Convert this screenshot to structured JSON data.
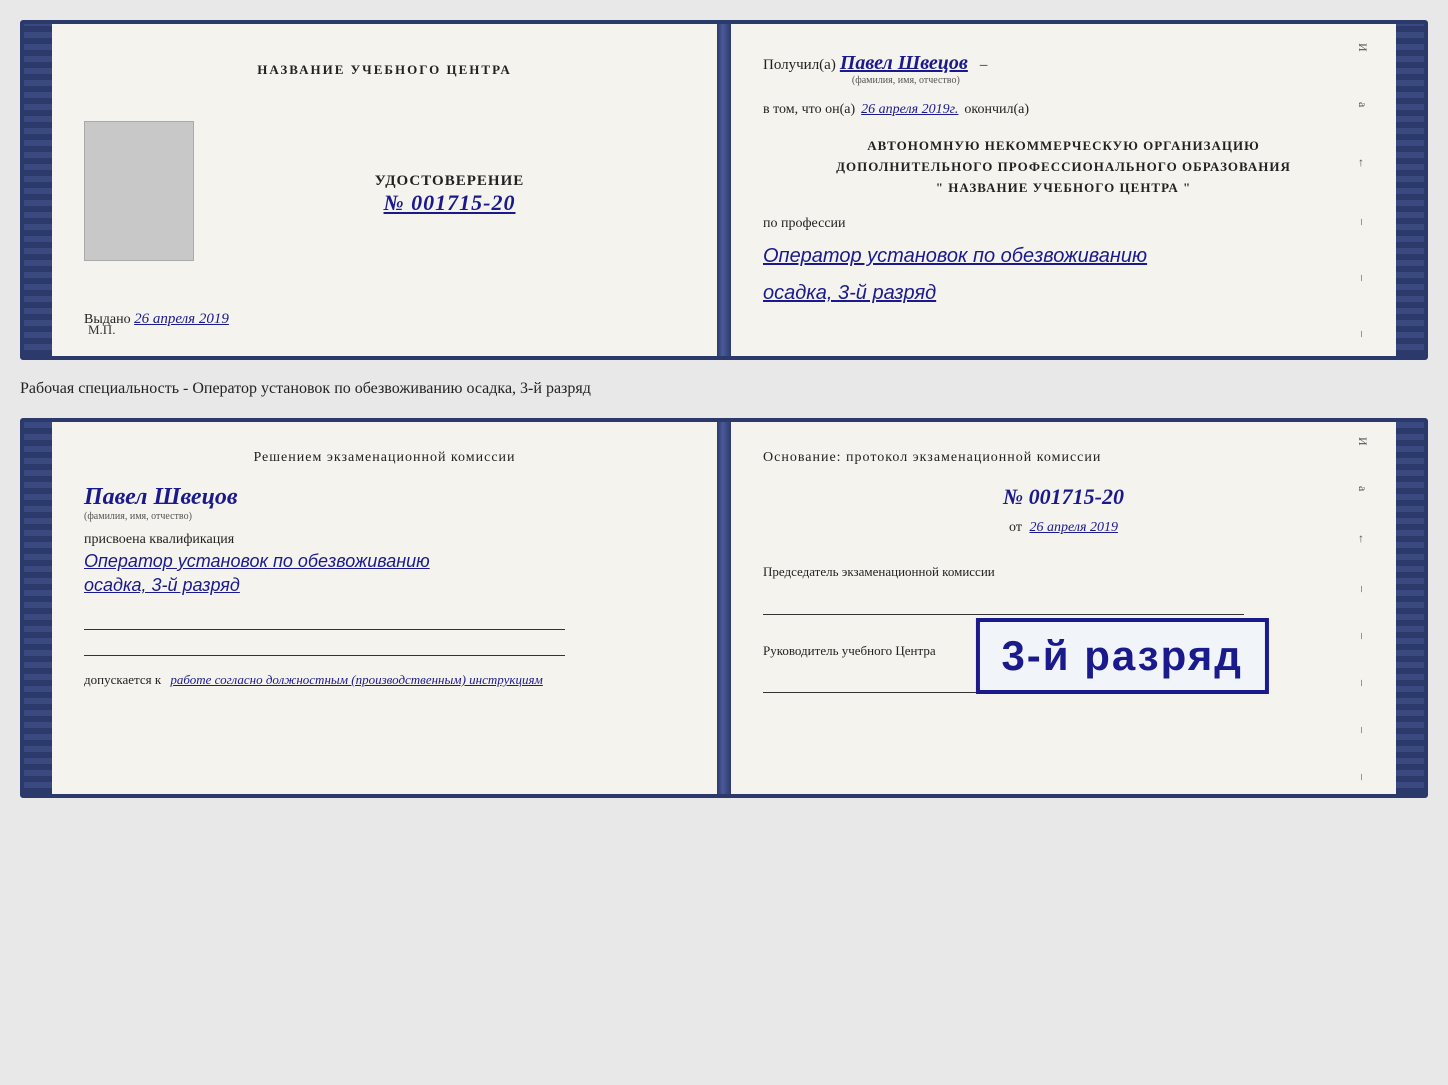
{
  "top_document": {
    "left": {
      "center_title": "НАЗВАНИЕ УЧЕБНОГО ЦЕНТРА",
      "cert_label": "УДОСТОВЕРЕНИЕ",
      "cert_number": "№ 001715-20",
      "issued_text": "Выдано",
      "issued_date": "26 апреля 2019",
      "mp_label": "М.П."
    },
    "right": {
      "received_prefix": "Получил(а)",
      "recipient_name": "Павел Швецов",
      "fio_label": "(фамилия, имя, отчество)",
      "that_prefix": "в том, что он(а)",
      "date_value": "26 апреля 2019г.",
      "finished_label": "окончил(а)",
      "org_line1": "АВТОНОМНУЮ НЕКОММЕРЧЕСКУЮ ОРГАНИЗАЦИЮ",
      "org_line2": "ДОПОЛНИТЕЛЬНОГО ПРОФЕССИОНАЛЬНОГО ОБРАЗОВАНИЯ",
      "org_line3": "\"  НАЗВАНИЕ УЧЕБНОГО ЦЕНТРА  \"",
      "profession_label": "по профессии",
      "profession_value": "Оператор установок по обезвоживанию",
      "rank_value": "осадка, 3-й разряд"
    }
  },
  "caption": "Рабочая специальность - Оператор установок по обезвоживанию осадка, 3-й разряд",
  "bottom_document": {
    "left": {
      "decision_title": "Решением экзаменационной комиссии",
      "person_name": "Павел Швецов",
      "fio_sublabel": "(фамилия, имя, отчество)",
      "qualification_label": "присвоена квалификация",
      "qualification_value": "Оператор установок по обезвоживанию",
      "rank_value": "осадка, 3-й разряд",
      "allows_prefix": "допускается к",
      "allows_value": "работе согласно должностным (производственным) инструкциям"
    },
    "right": {
      "basis_title": "Основание: протокол экзаменационной комиссии",
      "protocol_number": "№  001715-20",
      "from_prefix": "от",
      "from_date": "26 апреля 2019",
      "chairman_label": "Председатель экзаменационной комиссии",
      "director_label": "Руководитель учебного Центра"
    },
    "stamp": {
      "text": "3-й разряд"
    }
  },
  "right_deco": {
    "items": [
      "И",
      "а",
      "←",
      "–",
      "–",
      "–",
      "–",
      "–"
    ]
  }
}
